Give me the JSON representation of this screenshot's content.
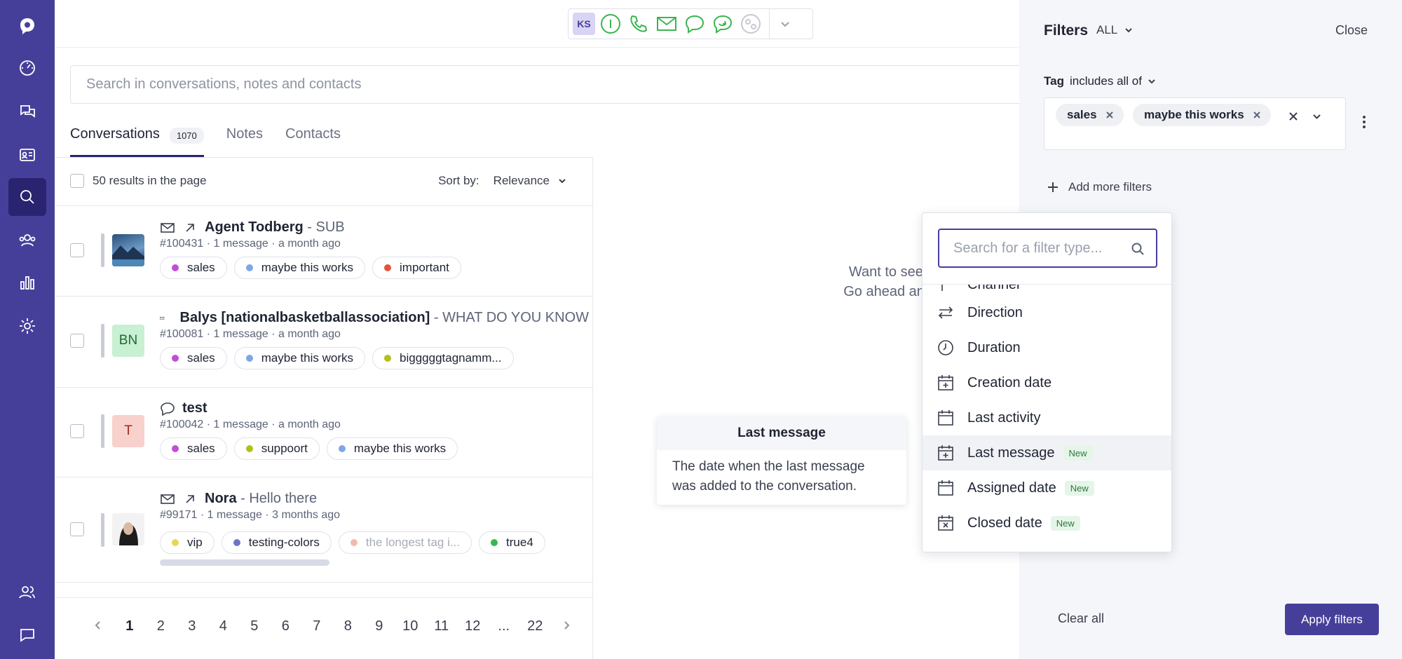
{
  "toolbar": {
    "initials": "KS"
  },
  "search": {
    "placeholder": "Search in conversations, notes and contacts"
  },
  "tabs": [
    {
      "label": "Conversations",
      "count": "1070"
    },
    {
      "label": "Notes"
    },
    {
      "label": "Contacts"
    }
  ],
  "results": {
    "label": "50 results in the page",
    "sort_label": "Sort by:",
    "sort_value": "Relevance"
  },
  "rows": [
    {
      "name": "Agent Todberg",
      "subject": " - SUB",
      "meta": "#100431 · 1 message · a month ago",
      "tags": [
        {
          "label": "sales",
          "color": "#c04fd6"
        },
        {
          "label": "maybe this works",
          "color": "#7ea7e8"
        },
        {
          "label": "important",
          "color": "#e5533d"
        }
      ]
    },
    {
      "name": "Balys [nationalbasketballassociation]",
      "subject": " - WHAT DO YOU KNOW",
      "meta": "#100081 · 1 message · a month ago",
      "avatar": "BN",
      "tags": [
        {
          "label": "sales",
          "color": "#c04fd6"
        },
        {
          "label": "maybe this works",
          "color": "#7ea7e8"
        },
        {
          "label": "bigggggtagnamm...",
          "color": "#b2c01a"
        }
      ]
    },
    {
      "name": "test",
      "subject": "",
      "meta": "#100042 · 1 message · a month ago",
      "avatar": "T",
      "tags": [
        {
          "label": "sales",
          "color": "#c04fd6"
        },
        {
          "label": "suppoort",
          "color": "#b2c01a"
        },
        {
          "label": "maybe this works",
          "color": "#7ea7e8"
        }
      ]
    },
    {
      "name": "Nora",
      "subject": " - Hello there",
      "meta": "#99171 · 1 message · 3 months ago",
      "tags": [
        {
          "label": "vip",
          "color": "#e8d65a"
        },
        {
          "label": "testing-colors",
          "color": "#6f74c2"
        },
        {
          "label": "the longest tag i...",
          "color": "#f3b8b0"
        },
        {
          "label": "true4",
          "color": "#3cb551"
        }
      ]
    }
  ],
  "pager": [
    "1",
    "2",
    "3",
    "4",
    "5",
    "6",
    "7",
    "8",
    "9",
    "10",
    "11",
    "12",
    "...",
    "22"
  ],
  "preview": {
    "line1": "Want to see a preview?",
    "line2": "Go ahead and select one"
  },
  "tooltip": {
    "title": "Last message",
    "body": "The date when the last message was added to the conversation."
  },
  "filters": {
    "title": "Filters",
    "scope": "ALL",
    "close": "Close",
    "tag_key": "Tag",
    "tag_op": "includes all of",
    "chips": [
      "sales",
      "maybe this works"
    ],
    "add_more": "Add more filters",
    "clear_all": "Clear all",
    "apply": "Apply filters"
  },
  "dropdown": {
    "placeholder": "Search for a filter type...",
    "items": [
      {
        "label": "Channel",
        "icon": "channel-icon"
      },
      {
        "label": "Direction",
        "icon": "direction-icon"
      },
      {
        "label": "Duration",
        "icon": "clock-icon"
      },
      {
        "label": "Creation date",
        "icon": "calendar-plus-icon"
      },
      {
        "label": "Last activity",
        "icon": "calendar-icon"
      },
      {
        "label": "Last message",
        "icon": "calendar-plus-icon",
        "badge": "New"
      },
      {
        "label": "Assigned date",
        "icon": "calendar-icon",
        "badge": "New"
      },
      {
        "label": "Closed date",
        "icon": "calendar-x-icon",
        "badge": "New"
      }
    ]
  },
  "colors": {
    "rail": "#463f9a",
    "rail_active": "#2a2470",
    "call_green": "#3cb551",
    "accent": "#463f9a"
  }
}
